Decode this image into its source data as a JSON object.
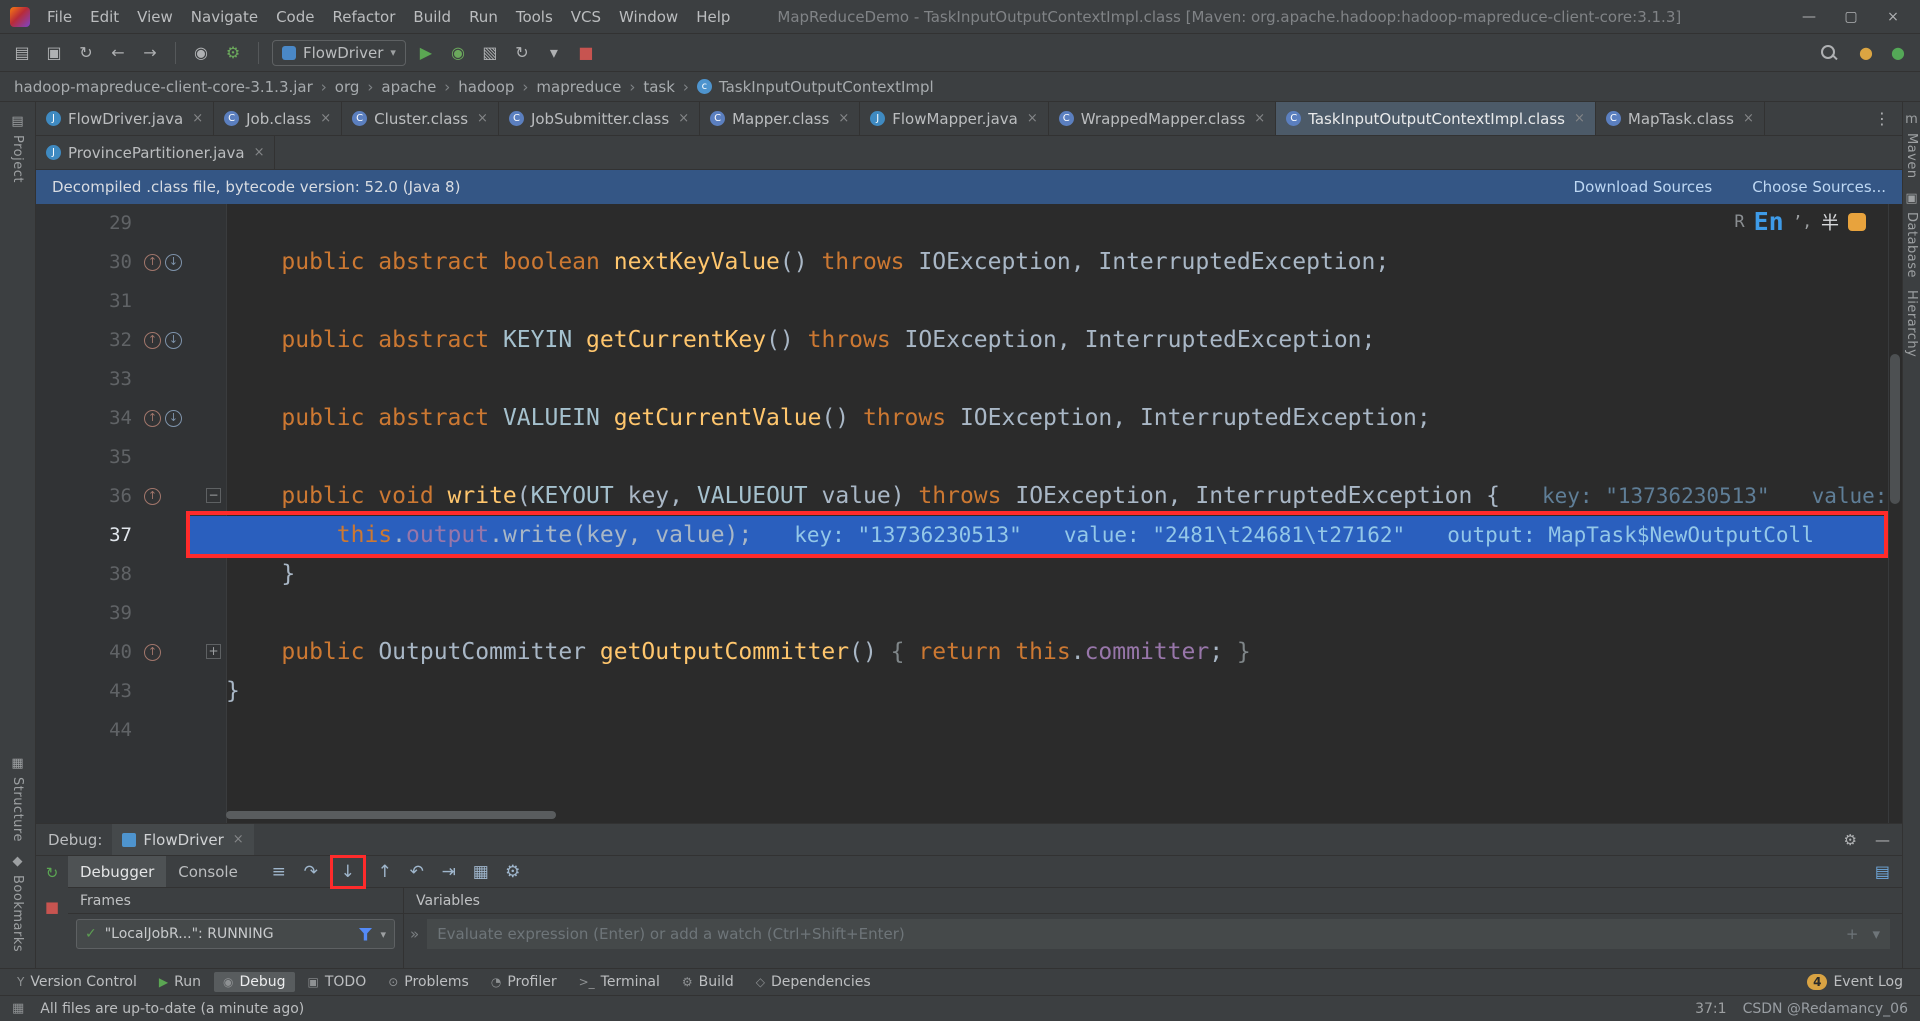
{
  "window": {
    "title": "MapReduceDemo - TaskInputOutputContextImpl.class [Maven: org.apache.hadoop:hadoop-mapreduce-client-core:3.1.3]",
    "menu": [
      "File",
      "Edit",
      "View",
      "Navigate",
      "Code",
      "Refactor",
      "Build",
      "Run",
      "Tools",
      "VCS",
      "Window",
      "Help"
    ],
    "controls": [
      {
        "name": "minimize-icon",
        "glyph": "—"
      },
      {
        "name": "maximize-icon",
        "glyph": "▢"
      },
      {
        "name": "close-icon",
        "glyph": "×"
      }
    ]
  },
  "toolbar": {
    "run_config": "FlowDriver",
    "left_icons": [
      {
        "n": "open-project-icon",
        "g": "▤"
      },
      {
        "n": "save-all-icon",
        "g": "▣"
      },
      {
        "n": "sync-icon",
        "g": "↻"
      },
      {
        "n": "back-icon",
        "g": "←"
      },
      {
        "n": "forward-icon",
        "g": "→"
      },
      {
        "sep": true
      },
      {
        "n": "profile-icon",
        "g": "◉"
      },
      {
        "n": "inspect-wrench-icon",
        "g": "⚙",
        "c": "#6BA85C"
      },
      {
        "sep": true
      }
    ],
    "run_icons": [
      {
        "n": "run-icon",
        "g": "▶",
        "c": "#5BA653"
      },
      {
        "n": "debug-icon",
        "g": "◉",
        "c": "#6BA85C"
      },
      {
        "n": "coverage-icon",
        "g": "▧"
      },
      {
        "n": "profiler-icon",
        "g": "↻"
      },
      {
        "n": "run-dropdown-icon",
        "g": "▾"
      },
      {
        "n": "stop-icon",
        "g": "■",
        "c": "#C75450"
      }
    ],
    "right_icons": [
      {
        "n": "ide-update-icon",
        "g": "●",
        "c": "#DBA542"
      },
      {
        "n": "plugin-icon",
        "g": "●",
        "c": "#54A857"
      }
    ]
  },
  "breadcrumbs": {
    "items": [
      "hadoop-mapreduce-client-core-3.1.3.jar",
      "org",
      "apache",
      "hadoop",
      "mapreduce",
      "task",
      "TaskInputOutputContextImpl"
    ]
  },
  "tabs": {
    "row1": [
      {
        "label": "FlowDriver.java",
        "type": "j"
      },
      {
        "label": "Job.class",
        "type": "c"
      },
      {
        "label": "Cluster.class",
        "type": "c"
      },
      {
        "label": "JobSubmitter.class",
        "type": "c"
      },
      {
        "label": "Mapper.class",
        "type": "c"
      },
      {
        "label": "FlowMapper.java",
        "type": "j"
      },
      {
        "label": "WrappedMapper.class",
        "type": "c"
      },
      {
        "label": "TaskInputOutputContextImpl.class",
        "type": "c",
        "active": true
      },
      {
        "label": "MapTask.class",
        "type": "c"
      }
    ],
    "row2": [
      {
        "label": "ProvincePartitioner.java",
        "type": "j"
      }
    ],
    "more_icon": "⋮"
  },
  "banner": {
    "text": "Decompiled .class file, bytecode version: 52.0 (Java 8)",
    "link1": "Download Sources",
    "link2": "Choose Sources..."
  },
  "ime": {
    "r": "R",
    "lang": "En",
    "punct": "’,",
    "shape": "半"
  },
  "editor": {
    "lines": [
      {
        "num": "29"
      },
      {
        "num": "30",
        "gutter": [
          "override",
          "implement"
        ],
        "indent": 1,
        "code": [
          [
            "kw",
            "public abstract boolean "
          ],
          [
            "m",
            "nextKeyValue"
          ],
          [
            "p",
            "() "
          ],
          [
            "kw",
            "throws"
          ],
          [
            "p",
            " IOException, InterruptedException;"
          ]
        ]
      },
      {
        "num": "31"
      },
      {
        "num": "32",
        "gutter": [
          "override",
          "implement"
        ],
        "indent": 1,
        "code": [
          [
            "kw",
            "public abstract "
          ],
          [
            "tp",
            "KEYIN"
          ],
          [
            "p",
            " "
          ],
          [
            "m",
            "getCurrentKey"
          ],
          [
            "p",
            "() "
          ],
          [
            "kw",
            "throws"
          ],
          [
            "p",
            " IOException, InterruptedException;"
          ]
        ]
      },
      {
        "num": "33"
      },
      {
        "num": "34",
        "gutter": [
          "override",
          "implement"
        ],
        "indent": 1,
        "code": [
          [
            "kw",
            "public abstract "
          ],
          [
            "tp",
            "VALUEIN"
          ],
          [
            "p",
            " "
          ],
          [
            "m",
            "getCurrentValue"
          ],
          [
            "p",
            "() "
          ],
          [
            "kw",
            "throws"
          ],
          [
            "p",
            " IOException, InterruptedException;"
          ]
        ]
      },
      {
        "num": "35"
      },
      {
        "num": "36",
        "gutter": [
          "override"
        ],
        "fold": "−",
        "indent": 1,
        "code": [
          [
            "kw",
            "public void "
          ],
          [
            "m",
            "write"
          ],
          [
            "p",
            "("
          ],
          [
            "tp",
            "KEYOUT"
          ],
          [
            "p",
            " key, "
          ],
          [
            "tp",
            "VALUEOUT"
          ],
          [
            "p",
            " value) "
          ],
          [
            "kw",
            "throws"
          ],
          [
            "p",
            " IOException, InterruptedException {"
          ]
        ],
        "hints": [
          "key: \"13736230513\"",
          "value:"
        ]
      },
      {
        "num": "37",
        "exec": true,
        "indent": 2,
        "code": [
          [
            "kw",
            "this"
          ],
          [
            "p",
            "."
          ],
          [
            "fld",
            "output"
          ],
          [
            "p",
            "."
          ],
          [
            "p",
            "write"
          ],
          [
            "p",
            "(key, value);"
          ]
        ],
        "hints": [
          "key: \"13736230513\"",
          "value: \"2481\\t24681\\t27162\"",
          "output: MapTask$NewOutputColl"
        ]
      },
      {
        "num": "38",
        "indent": 1,
        "code": [
          [
            "p",
            "}"
          ]
        ]
      },
      {
        "num": "39"
      },
      {
        "num": "40",
        "gutter": [
          "override"
        ],
        "fold": "+",
        "indent": 1,
        "code": [
          [
            "kw",
            "public "
          ],
          [
            "p",
            "OutputCommitter "
          ],
          [
            "m",
            "getOutputCommitter"
          ],
          [
            "p",
            "() "
          ],
          [
            "dim",
            "{ "
          ],
          [
            "kw",
            "return "
          ],
          [
            "kw",
            "this"
          ],
          [
            "p",
            "."
          ],
          [
            "fld",
            "committer"
          ],
          [
            "p",
            "; "
          ],
          [
            "dim",
            "}"
          ]
        ]
      },
      {
        "num": "43",
        "indent": 0,
        "code": [
          [
            "p",
            "}"
          ]
        ]
      },
      {
        "num": "44"
      }
    ]
  },
  "debug": {
    "label": "Debug:",
    "tab": "FlowDriver",
    "tabs": [
      {
        "label": "Debugger",
        "active": true
      },
      {
        "label": "Console",
        "active": false
      }
    ],
    "step_icons": [
      {
        "name": "show-execution-point-icon",
        "glyph": "≡"
      },
      {
        "name": "step-over-icon",
        "glyph": "↷"
      },
      {
        "name": "step-into-icon",
        "glyph": "↓",
        "annotated": true
      },
      {
        "name": "step-out-icon",
        "glyph": "↑"
      },
      {
        "name": "drop-frame-icon",
        "glyph": "↶"
      },
      {
        "name": "run-to-cursor-icon",
        "glyph": "⇥"
      },
      {
        "name": "evaluate-expression-icon",
        "glyph": "▦"
      },
      {
        "name": "view-options-icon",
        "glyph": "⚙"
      }
    ],
    "layout_icon": "▤",
    "strip_icons": [
      {
        "name": "rerun-icon",
        "glyph": "↻",
        "color": "#5BA653"
      },
      {
        "name": "stop-process-icon",
        "glyph": "■",
        "color": "#C75450"
      }
    ],
    "frames": {
      "header": "Frames",
      "thread": "\"LocalJobR...\": RUNNING"
    },
    "variables": {
      "header": "Variables",
      "placeholder": "Evaluate expression (Enter) or add a watch (Ctrl+Shift+Enter)"
    }
  },
  "toolbuttons": {
    "left": [
      {
        "name": "version-control",
        "label": "Version Control",
        "glyph": "Y"
      },
      {
        "name": "run",
        "label": "Run",
        "glyph": "▶",
        "cls": "run"
      },
      {
        "name": "debug",
        "label": "Debug",
        "glyph": "◉",
        "active": true
      },
      {
        "name": "todo",
        "label": "TODO",
        "glyph": "▣"
      },
      {
        "name": "problems",
        "label": "Problems",
        "glyph": "⊙"
      },
      {
        "name": "profiler",
        "label": "Profiler",
        "glyph": "◔"
      },
      {
        "name": "terminal",
        "label": "Terminal",
        "glyph": ">_"
      },
      {
        "name": "build",
        "label": "Build",
        "glyph": "⚙"
      },
      {
        "name": "dependencies",
        "label": "Dependencies",
        "glyph": "◇"
      }
    ],
    "eventlog_badge": "4",
    "eventlog_label": "Event Log"
  },
  "statusbar": {
    "message": "All files are up-to-date (a minute ago)",
    "position": "37:1",
    "watermark": "CSDN @Redamancy_06"
  },
  "stripes": {
    "left": [
      {
        "icon": "▤",
        "label": "Project"
      },
      {
        "icon": "▦",
        "label": "Structure"
      },
      {
        "icon": "◆",
        "label": "Bookmarks"
      }
    ],
    "right": [
      {
        "icon": "m",
        "label": "Maven"
      },
      {
        "icon": "▣",
        "label": "Database"
      },
      {
        "icon": "",
        "label": "Hierarchy"
      }
    ]
  }
}
